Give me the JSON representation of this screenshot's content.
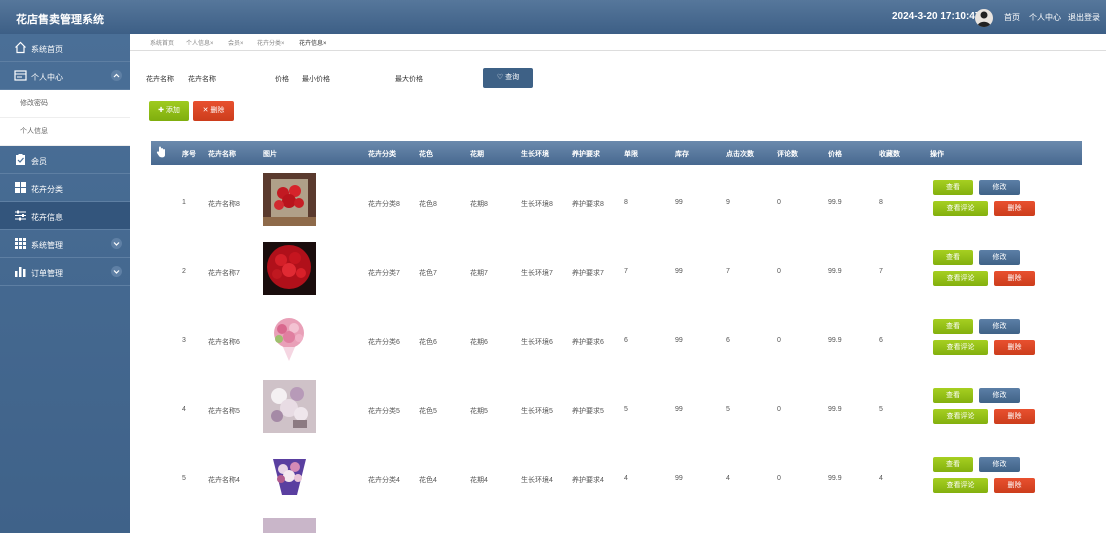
{
  "header": {
    "title": "花店售卖管理系统",
    "datetime": "2024-3-20 17:10:47",
    "links": [
      "首页",
      "个人中心",
      "退出登录"
    ]
  },
  "sidebar": {
    "items": [
      {
        "label": "系统首页",
        "icon": "home-icon"
      },
      {
        "label": "个人中心",
        "icon": "user-card-icon",
        "expanded": true,
        "children": [
          "修改密码",
          "个人信息"
        ]
      },
      {
        "label": "会员",
        "icon": "clipboard-icon"
      },
      {
        "label": "花卉分类",
        "icon": "grid-icon"
      },
      {
        "label": "花卉信息",
        "icon": "sliders-icon",
        "active": true
      },
      {
        "label": "系统管理",
        "icon": "apps-icon",
        "expandable": true
      },
      {
        "label": "订单管理",
        "icon": "bar-chart-icon",
        "expandable": true
      }
    ]
  },
  "tabs": [
    {
      "label": "系统首页"
    },
    {
      "label": "个人信息",
      "closable": true
    },
    {
      "label": "会员",
      "closable": true
    },
    {
      "label": "花卉分类",
      "closable": true
    },
    {
      "label": "花卉信息",
      "closable": true,
      "active": true
    }
  ],
  "tab_close": "×",
  "search": {
    "name_label": "花卉名称",
    "name_placeholder": "花卉名称",
    "price_label": "价格",
    "price_min_placeholder": "最小价格",
    "price_max_placeholder": "最大价格",
    "query_button": "查询"
  },
  "actions": {
    "add": "添加",
    "delete": "删除"
  },
  "table": {
    "headers": [
      "序号",
      "花卉名称",
      "图片",
      "花卉分类",
      "花色",
      "花期",
      "生长环境",
      "养护要求",
      "单限",
      "库存",
      "点击次数",
      "评论数",
      "价格",
      "收藏数",
      "操作"
    ],
    "rows": [
      {
        "index": "1",
        "name": "花卉名称8",
        "category": "花卉分类8",
        "color": "花色8",
        "period": "花期8",
        "env": "生长环境8",
        "care": "养护要求8",
        "limit": "8",
        "stock": "99",
        "clicks": "9",
        "comments": "0",
        "price": "99.9",
        "favorites": "8"
      },
      {
        "index": "2",
        "name": "花卉名称7",
        "category": "花卉分类7",
        "color": "花色7",
        "period": "花期7",
        "env": "生长环境7",
        "care": "养护要求7",
        "limit": "7",
        "stock": "99",
        "clicks": "7",
        "comments": "0",
        "price": "99.9",
        "favorites": "7"
      },
      {
        "index": "3",
        "name": "花卉名称6",
        "category": "花卉分类6",
        "color": "花色6",
        "period": "花期6",
        "env": "生长环境6",
        "care": "养护要求6",
        "limit": "6",
        "stock": "99",
        "clicks": "6",
        "comments": "0",
        "price": "99.9",
        "favorites": "6"
      },
      {
        "index": "4",
        "name": "花卉名称5",
        "category": "花卉分类5",
        "color": "花色5",
        "period": "花期5",
        "env": "生长环境5",
        "care": "养护要求5",
        "limit": "5",
        "stock": "99",
        "clicks": "5",
        "comments": "0",
        "price": "99.9",
        "favorites": "5"
      },
      {
        "index": "5",
        "name": "花卉名称4",
        "category": "花卉分类4",
        "color": "花色4",
        "period": "花期4",
        "env": "生长环境4",
        "care": "养护要求4",
        "limit": "4",
        "stock": "99",
        "clicks": "4",
        "comments": "0",
        "price": "99.9",
        "favorites": "4"
      }
    ],
    "op_labels": {
      "view": "查看",
      "edit": "修改",
      "comment": "查看评论",
      "delete": "删除"
    }
  },
  "colors": {
    "header_bg": "#4a6c92",
    "sidebar_bg": "#45698f",
    "sidebar_active": "#33557c",
    "view_button": "#8dbb15",
    "edit_button": "#4a6d93",
    "delete_button": "#d9441f"
  }
}
